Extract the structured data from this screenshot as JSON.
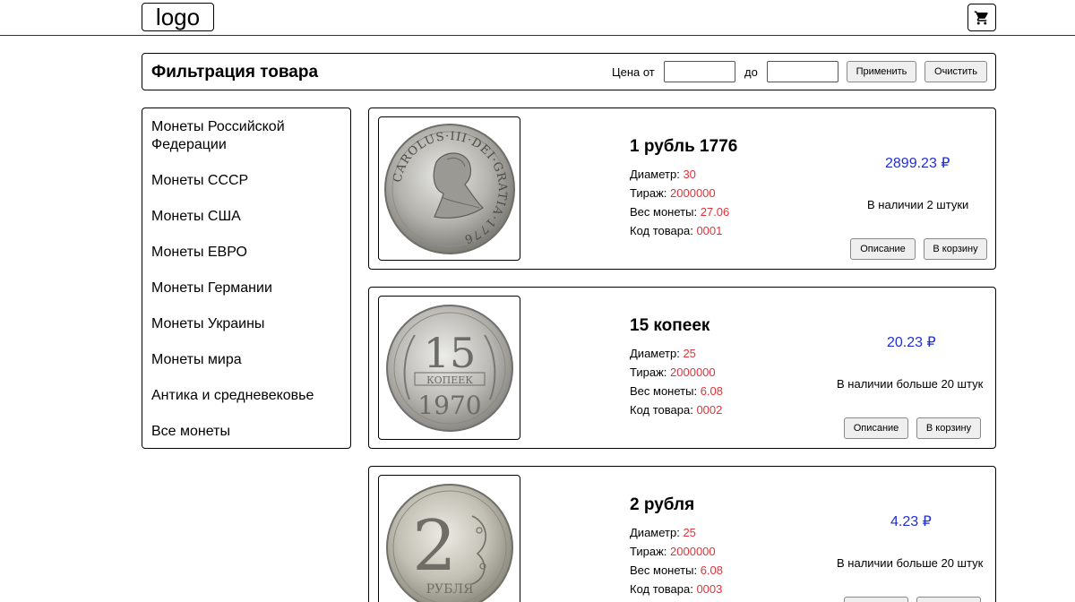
{
  "header": {
    "logo_text": "logo",
    "cart_icon": "cart-icon"
  },
  "filter": {
    "title": "Фильтрация товара",
    "price_from_label": "Цена от",
    "price_to_label": "до",
    "price_from_value": "",
    "price_to_value": "",
    "apply_label": "Применить",
    "clear_label": "Очистить"
  },
  "sidebar": {
    "items": [
      {
        "label": "Монеты Российской Федерации"
      },
      {
        "label": "Монеты СССР"
      },
      {
        "label": "Монеты США"
      },
      {
        "label": "Монеты ЕВРО"
      },
      {
        "label": "Монеты Германии"
      },
      {
        "label": "Монеты Украины"
      },
      {
        "label": "Монеты мира"
      },
      {
        "label": "Антика и средневековье"
      },
      {
        "label": "Все монеты"
      }
    ]
  },
  "labels": {
    "diameter": "Диаметр:",
    "mintage": "Тираж:",
    "weight": "Вес монеты:",
    "code": "Код товара:",
    "description_btn": "Описание",
    "cart_btn": "В корзину"
  },
  "products": [
    {
      "name": "1 рубль 1776",
      "diameter": "30",
      "mintage": "2000000",
      "weight": "27.06",
      "code": "0001",
      "price": "2899.23 ₽",
      "stock": "В наличии 2 штуки",
      "coin_inscription": "CAROLUS·III·DEI·GRATIA·1776"
    },
    {
      "name": "15 копеек",
      "diameter": "25",
      "mintage": "2000000",
      "weight": "6.08",
      "code": "0002",
      "price": "20.23 ₽",
      "stock": "В наличии больше 20 штук",
      "coin_denomination": "15",
      "coin_unit": "КОПЕЕК",
      "coin_year": "1970"
    },
    {
      "name": "2 рубля",
      "diameter": "25",
      "mintage": "2000000",
      "weight": "6.08",
      "code": "0003",
      "price": "4.23 ₽",
      "stock": "В наличии больше 20 штук",
      "coin_denomination": "2",
      "coin_unit": "РУБЛЯ"
    }
  ],
  "colors": {
    "price": "#1f2fd4",
    "spec_value": "#e0333a",
    "border": "#000000"
  }
}
